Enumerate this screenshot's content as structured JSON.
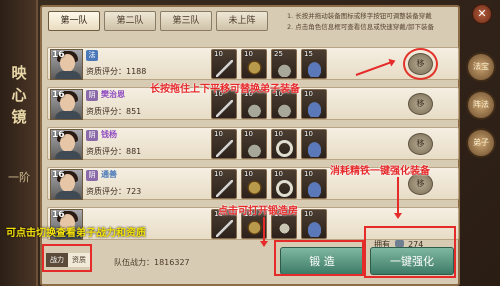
{
  "side_title": {
    "title": "映心镜",
    "subtitle": "一阶"
  },
  "tabs": [
    {
      "label": "第一队",
      "active": true
    },
    {
      "label": "第二队"
    },
    {
      "label": "第三队"
    },
    {
      "label": "未上阵"
    }
  ],
  "tips": [
    "1. 长按并拖动装备图标或移字按钮可调整装备穿戴",
    "2. 点击角色信息框可查看信息或快速穿戴/卸下装备"
  ],
  "rows": [
    {
      "level": "16",
      "school": "法",
      "name": "",
      "name_color": "#e8d23a",
      "score_label": "资质评分：1188",
      "move": "移",
      "slots": [
        {
          "n": "10",
          "icon": "sword"
        },
        {
          "n": "10",
          "icon": "armor"
        },
        {
          "n": "25",
          "icon": "helmet"
        },
        {
          "n": "15",
          "icon": "boots"
        }
      ]
    },
    {
      "level": "16",
      "school": "阴",
      "name": "樊治恩",
      "name_color": "#8f4bc2",
      "score_label": "资质评分：851",
      "move": "移",
      "slots": [
        {
          "n": "10",
          "icon": "sword"
        },
        {
          "n": "10",
          "icon": "helmet"
        },
        {
          "n": "10",
          "icon": "helmet"
        },
        {
          "n": "10",
          "icon": "boots"
        }
      ]
    },
    {
      "level": "16",
      "school": "阴",
      "name": "钱杨",
      "name_color": "#8f4bc2",
      "score_label": "资质评分：881",
      "move": "移",
      "slots": [
        {
          "n": "10",
          "icon": "sword"
        },
        {
          "n": "10",
          "icon": "helmet"
        },
        {
          "n": "10",
          "icon": "rope"
        },
        {
          "n": "10",
          "icon": "boots"
        }
      ]
    },
    {
      "level": "16",
      "school": "阴",
      "name": "通善",
      "name_color": "#4a78b8",
      "score_label": "资质评分：723",
      "move": "移",
      "slots": [
        {
          "n": "10",
          "icon": "sword"
        },
        {
          "n": "10",
          "icon": "armor"
        },
        {
          "n": "10",
          "icon": "rope"
        },
        {
          "n": "10",
          "icon": "boots"
        }
      ]
    },
    {
      "level": "16",
      "school": "",
      "name": "",
      "name_color": "#4a78b8",
      "score_label": "",
      "move": "",
      "slots": [
        {
          "n": "10",
          "icon": "sword"
        },
        {
          "n": "10",
          "icon": "armor"
        },
        {
          "n": "10",
          "icon": "stone"
        },
        {
          "n": "10",
          "icon": "boots"
        }
      ]
    }
  ],
  "annotations": {
    "drag": "长按拖住上下平移可替换弟子装备",
    "strengthen": "消耗精铁一键强化装备",
    "forge": "点击可打开锻造房",
    "toggle": "可点击切换查看弟子战力和资质"
  },
  "bottom": {
    "zhanli": "战力",
    "zizhi": "资质",
    "total": "队伍战力：1816327",
    "own_label": "拥有",
    "own_value": "274",
    "forge": "锻 造",
    "onekey": "一键强化"
  },
  "side": {
    "close": "✕",
    "items": [
      "法宝",
      "阵法",
      "弟子"
    ]
  },
  "colors": {
    "accent_red": "#e52a2a",
    "tip_yellow": "#f4e10a",
    "button_green": "#3d7b66"
  }
}
